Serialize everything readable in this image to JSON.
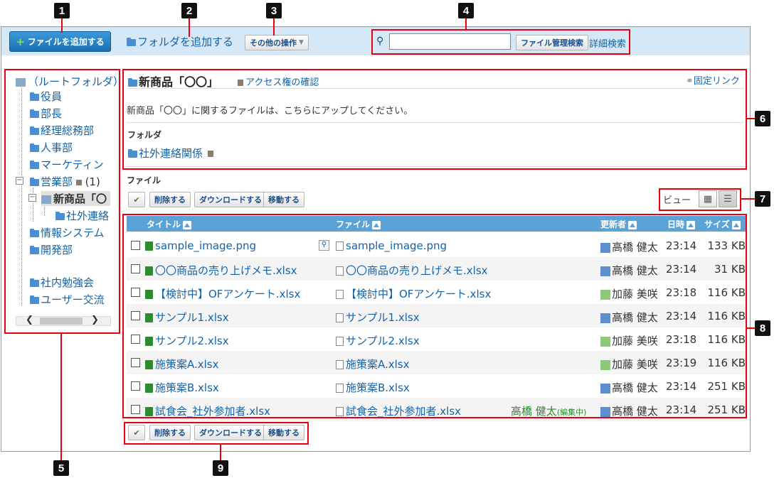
{
  "toolbar": {
    "add_file_label": "ファイルを追加する",
    "add_folder_label": "フォルダを追加する",
    "other_ops_label": "その他の操作",
    "search_placeholder": "",
    "search_button_label": "ファイル管理検索",
    "advanced_search_label": "詳細検索"
  },
  "tree": {
    "root": "（ルートフォルダ）",
    "items": [
      "役員",
      "部長",
      "経理総務部",
      "人事部",
      "マーケティン",
      "営業部",
      "新商品「〇",
      "社外連絡",
      "情報システム",
      "開発部",
      "社内勉強会",
      "ユーザー交流"
    ],
    "sales_count": "(1)"
  },
  "folder": {
    "title": "新商品「〇〇」",
    "access_link": "アクセス権の確認",
    "permalink": "固定リンク",
    "description": "新商品「〇〇」に関するファイルは、こちらにアップしてください。",
    "subfolders_label": "フォルダ",
    "subfolder_name": "社外連絡関係",
    "files_label": "ファイル"
  },
  "actions": {
    "delete": "削除する",
    "download": "ダウンロードする",
    "move": "移動する",
    "view_label": "ビュー"
  },
  "table": {
    "headers": {
      "title": "タイトル",
      "file": "ファイル",
      "updater": "更新者",
      "date": "日時",
      "size": "サイズ"
    },
    "rows": [
      {
        "title": "sample_image.png",
        "file": "sample_image.png",
        "editing": "",
        "updater": "高橋 健太",
        "date": "23:14",
        "size": "133 KB"
      },
      {
        "title": "〇〇商品の売り上げメモ.xlsx",
        "file": "〇〇商品の売り上げメモ.xlsx",
        "editing": "",
        "updater": "高橋 健太",
        "date": "23:14",
        "size": "31 KB"
      },
      {
        "title": "【検討中】OFアンケート.xlsx",
        "file": "【検討中】OFアンケート.xlsx",
        "editing": "",
        "updater": "加藤 美咲",
        "date": "23:18",
        "size": "116 KB"
      },
      {
        "title": "サンプル1.xlsx",
        "file": "サンプル1.xlsx",
        "editing": "",
        "updater": "高橋 健太",
        "date": "23:14",
        "size": "116 KB"
      },
      {
        "title": "サンプル2.xlsx",
        "file": "サンプル2.xlsx",
        "editing": "",
        "updater": "加藤 美咲",
        "date": "23:18",
        "size": "116 KB"
      },
      {
        "title": "施策案A.xlsx",
        "file": "施策案A.xlsx",
        "editing": "",
        "updater": "加藤 美咲",
        "date": "23:19",
        "size": "116 KB"
      },
      {
        "title": "施策案B.xlsx",
        "file": "施策案B.xlsx",
        "editing": "",
        "updater": "高橋 健太",
        "date": "23:14",
        "size": "251 KB"
      },
      {
        "title": "試食会_社外参加者.xlsx",
        "file": "試食会_社外参加者.xlsx",
        "editing_name": "高橋 健太",
        "editing_tag": "(編集中)",
        "updater": "高橋 健太",
        "date": "23:14",
        "size": "251 KB"
      }
    ]
  },
  "callouts": [
    "1",
    "2",
    "3",
    "4",
    "5",
    "6",
    "7",
    "8",
    "9"
  ],
  "colors": {
    "callout_border": "#e60012",
    "toolbar_bg": "#d6e7f5",
    "header_bg": "#5ba3d6",
    "link": "#1463a8"
  }
}
